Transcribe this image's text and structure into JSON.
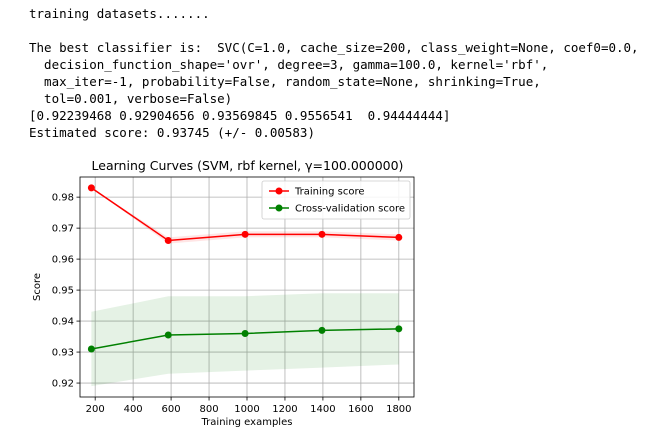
{
  "output": {
    "lines": [
      "training datasets.......",
      "",
      "The best classifier is:  SVC(C=1.0, cache_size=200, class_weight=None, coef0=0.0,",
      "  decision_function_shape='ovr', degree=3, gamma=100.0, kernel='rbf',",
      "  max_iter=-1, probability=False, random_state=None, shrinking=True,",
      "  tol=0.001, verbose=False)",
      "[0.92239468 0.92904656 0.93569845 0.9556541  0.94444444]",
      "Estimated score: 0.93745 (+/- 0.00583)"
    ]
  },
  "chart_data": {
    "type": "line",
    "title": "Learning Curves (SVM, rbf kernel, γ=100.000000)",
    "xlabel": "Training examples",
    "ylabel": "Score",
    "xlim": [
      120,
      1880
    ],
    "ylim": [
      0.9155,
      0.9865
    ],
    "xticks": [
      200,
      400,
      600,
      800,
      1000,
      1200,
      1400,
      1600,
      1800
    ],
    "yticks": [
      0.92,
      0.93,
      0.94,
      0.95,
      0.96,
      0.97,
      0.98
    ],
    "ytick_labels": [
      "0.92",
      "0.93",
      "0.94",
      "0.95",
      "0.96",
      "0.97",
      "0.98"
    ],
    "grid": true,
    "legend_position": "top-right",
    "x": [
      180,
      585,
      990,
      1395,
      1800
    ],
    "series": [
      {
        "name": "Training score",
        "color": "#ff0000",
        "fill_color": "#ff0000",
        "values": [
          0.983,
          0.966,
          0.968,
          0.968,
          0.967
        ],
        "lower": [
          0.983,
          0.965,
          0.967,
          0.967,
          0.966
        ],
        "upper": [
          0.983,
          0.967,
          0.969,
          0.969,
          0.968
        ]
      },
      {
        "name": "Cross-validation score",
        "color": "#008000",
        "fill_color": "#008000",
        "values": [
          0.931,
          0.9355,
          0.936,
          0.937,
          0.9375
        ],
        "lower": [
          0.919,
          0.923,
          0.924,
          0.925,
          0.926
        ],
        "upper": [
          0.943,
          0.948,
          0.948,
          0.949,
          0.949
        ]
      }
    ]
  }
}
